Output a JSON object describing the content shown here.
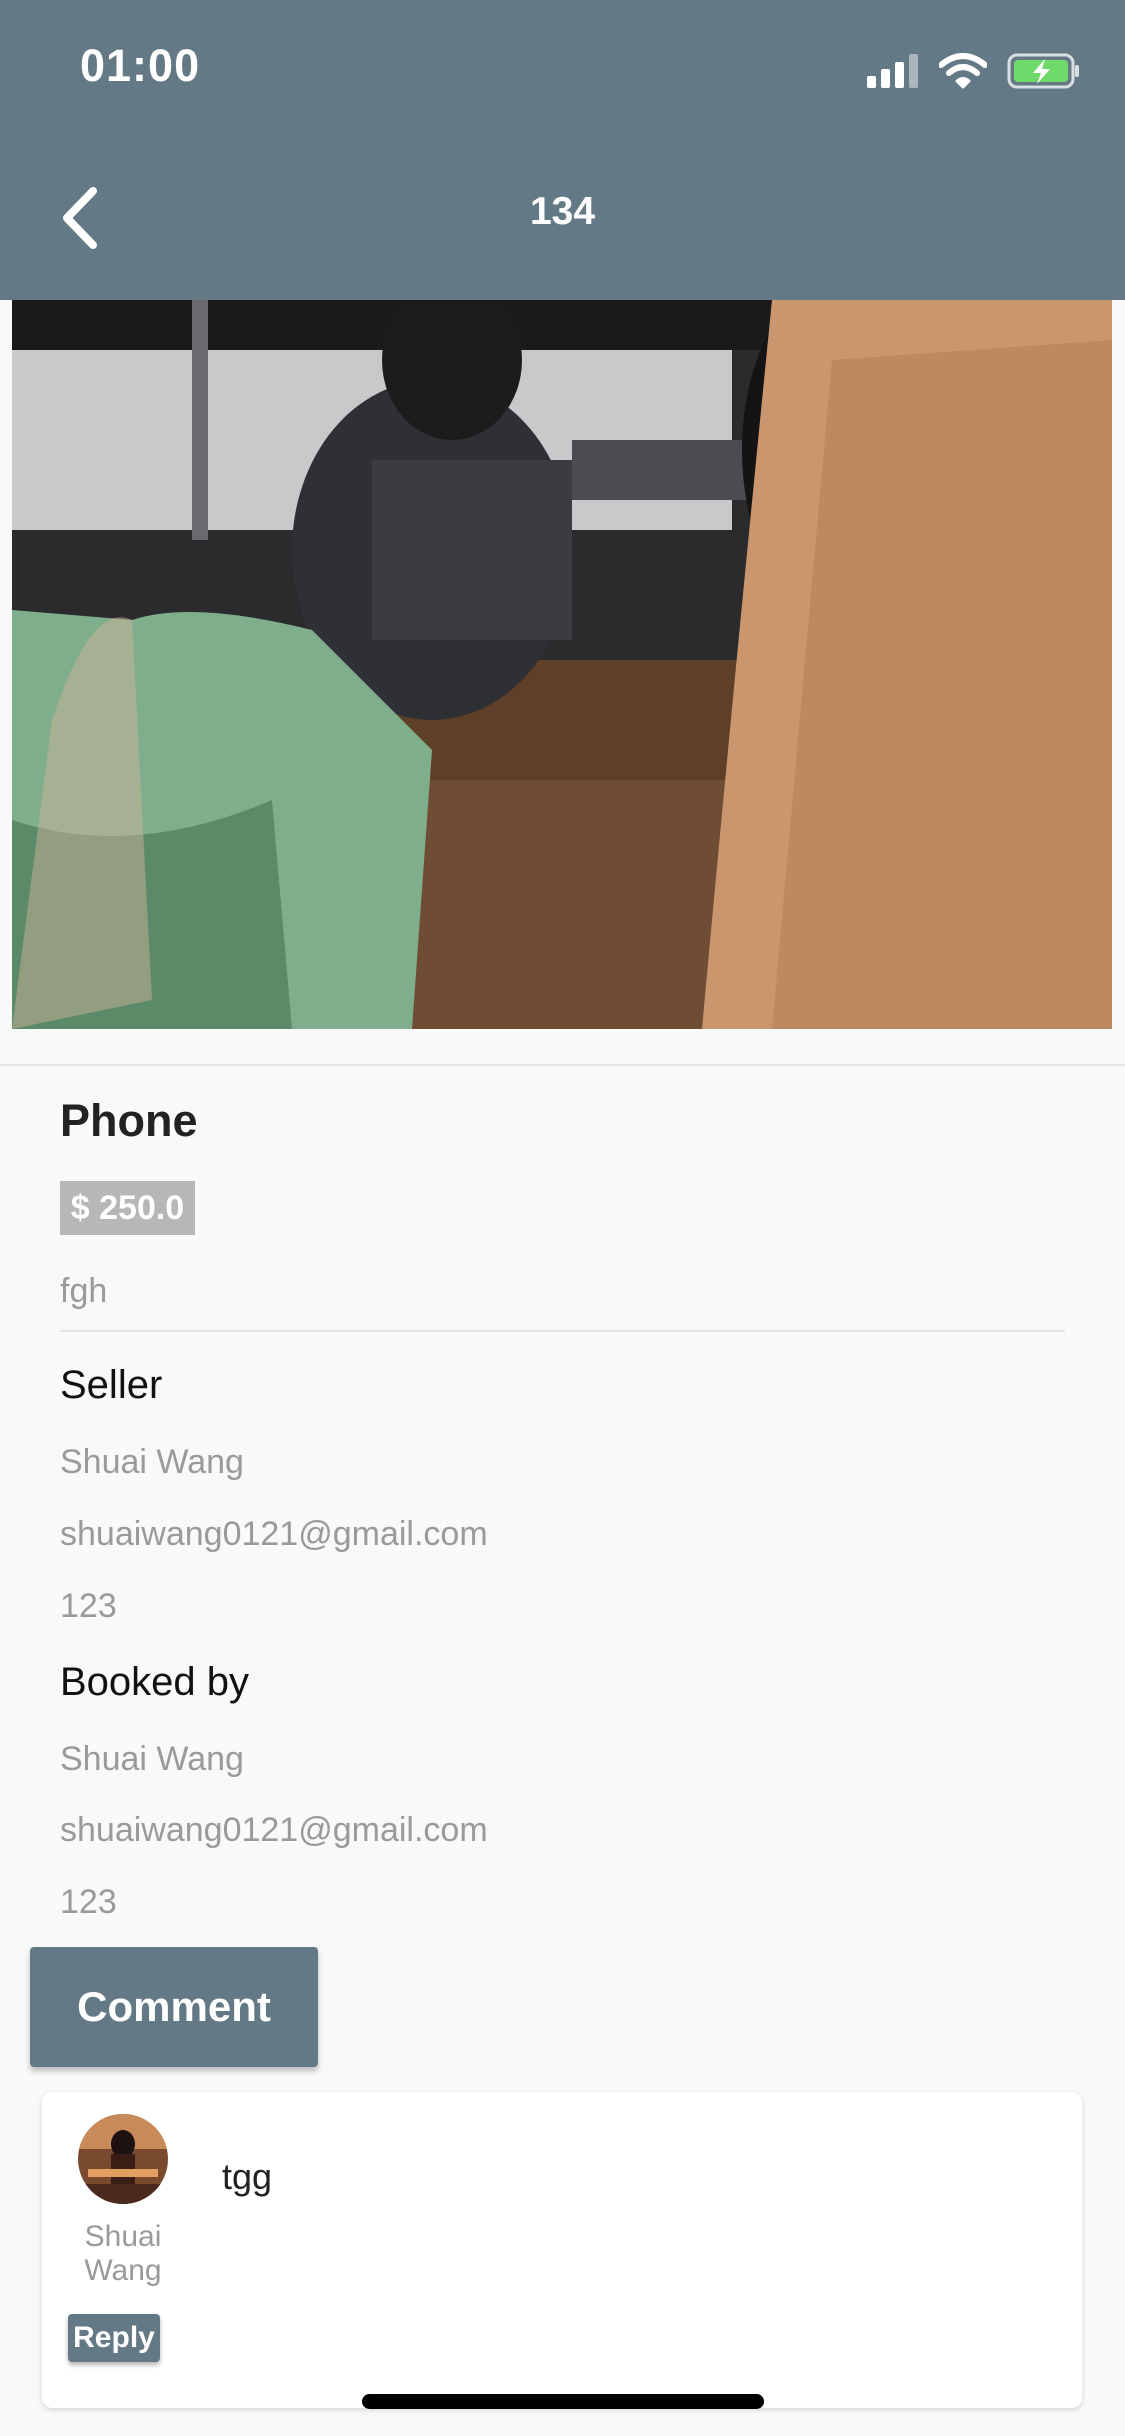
{
  "status_bar": {
    "time": "01:00"
  },
  "header": {
    "title": "134"
  },
  "product": {
    "name": "Phone",
    "price": "$ 250.0",
    "description": "fgh"
  },
  "seller": {
    "heading": "Seller",
    "name": "Shuai Wang",
    "email": "shuaiwang0121@gmail.com",
    "phone": "123"
  },
  "booked_by": {
    "heading": "Booked by",
    "name": "Shuai Wang",
    "email": "shuaiwang0121@gmail.com",
    "phone": "123"
  },
  "actions": {
    "comment_label": "Comment"
  },
  "comments": [
    {
      "author": "Shuai Wang",
      "text": "tgg",
      "reply_label": "Reply"
    }
  ],
  "colors": {
    "accent": "#647986",
    "price_badge": "#b7b7b7"
  }
}
